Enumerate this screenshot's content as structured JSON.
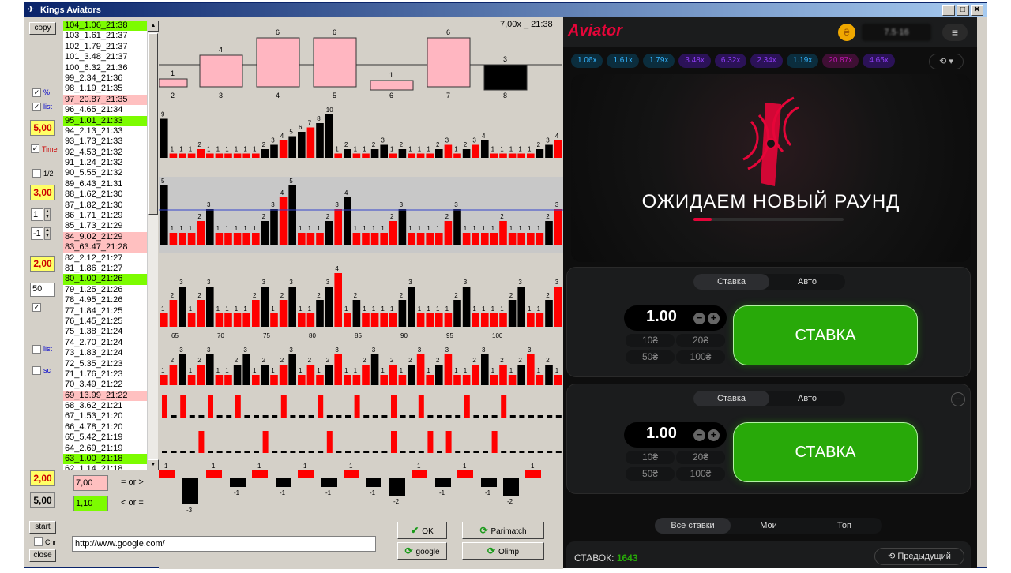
{
  "window": {
    "title": "Kings Aviators"
  },
  "left": {
    "copy": "copy",
    "pct_label": "%",
    "list_label": "list",
    "val1": "5,00",
    "time_label": "Time",
    "half_label": "1/2",
    "val2": "3,00",
    "spin1": "1",
    "spin2": "-1",
    "val3": "2,00",
    "field50": "50",
    "list2_label": "list",
    "sc_label": "sc",
    "val4": "2,00",
    "val5": "5,00",
    "start": "start",
    "chr_label": "Chr",
    "close": "close"
  },
  "list": [
    {
      "t": "104_1.06_21:38",
      "c": "g"
    },
    {
      "t": "103_1.61_21:37",
      "c": ""
    },
    {
      "t": "102_1.79_21:37",
      "c": ""
    },
    {
      "t": "101_3.48_21:37",
      "c": ""
    },
    {
      "t": "100_6.32_21:36",
      "c": ""
    },
    {
      "t": "99_2.34_21:36",
      "c": ""
    },
    {
      "t": "98_1.19_21:35",
      "c": ""
    },
    {
      "t": "97_20.87_21:35",
      "c": "p"
    },
    {
      "t": "96_4.65_21:34",
      "c": ""
    },
    {
      "t": "95_1.01_21:33",
      "c": "g"
    },
    {
      "t": "94_2.13_21:33",
      "c": ""
    },
    {
      "t": "93_1.73_21:33",
      "c": ""
    },
    {
      "t": "92_4.53_21:32",
      "c": ""
    },
    {
      "t": "91_1.24_21:32",
      "c": ""
    },
    {
      "t": "90_5.55_21:32",
      "c": ""
    },
    {
      "t": "89_6.43_21:31",
      "c": ""
    },
    {
      "t": "88_1.62_21:30",
      "c": ""
    },
    {
      "t": "87_1.82_21:30",
      "c": ""
    },
    {
      "t": "86_1.71_21:29",
      "c": ""
    },
    {
      "t": "85_1.73_21:29",
      "c": ""
    },
    {
      "t": "84_9.02_21:29",
      "c": "p"
    },
    {
      "t": "83_63.47_21:28",
      "c": "p"
    },
    {
      "t": "82_2.12_21:27",
      "c": ""
    },
    {
      "t": "81_1.86_21:27",
      "c": ""
    },
    {
      "t": "80_1.00_21:26",
      "c": "g"
    },
    {
      "t": "79_1.25_21:26",
      "c": ""
    },
    {
      "t": "78_4.95_21:26",
      "c": ""
    },
    {
      "t": "77_1.84_21:25",
      "c": ""
    },
    {
      "t": "76_1.45_21:25",
      "c": ""
    },
    {
      "t": "75_1.38_21:24",
      "c": ""
    },
    {
      "t": "74_2.70_21:24",
      "c": ""
    },
    {
      "t": "73_1.83_21:24",
      "c": ""
    },
    {
      "t": "72_5.35_21:23",
      "c": ""
    },
    {
      "t": "71_1.76_21:23",
      "c": ""
    },
    {
      "t": "70_3.49_21:22",
      "c": ""
    },
    {
      "t": "69_13.99_21:22",
      "c": "p"
    },
    {
      "t": "68_3.62_21:21",
      "c": ""
    },
    {
      "t": "67_1.53_21:20",
      "c": ""
    },
    {
      "t": "66_4.78_21:20",
      "c": ""
    },
    {
      "t": "65_5.42_21:19",
      "c": ""
    },
    {
      "t": "64_2.69_21:19",
      "c": ""
    },
    {
      "t": "63_1.00_21:18",
      "c": "g"
    },
    {
      "t": "62_1.14_21:18",
      "c": ""
    }
  ],
  "chart": {
    "header": "7,00x _ 21:38",
    "axis_ticks": [
      "65",
      "70",
      "75",
      "80",
      "85",
      "90",
      "95",
      "100"
    ]
  },
  "bottom": {
    "gt_val": "7,00",
    "gt_label": "= or >",
    "lt_val": "1,10",
    "lt_label": "< or =",
    "url": "http://www.google.com/",
    "ok": "OK",
    "google": "google",
    "parimatch": "Parimatch",
    "olimp": "Olimp"
  },
  "game": {
    "logo": "Aviator",
    "balance": "7.5·16",
    "coin": "₴",
    "multipliers": [
      {
        "v": "1.06x",
        "c": "bl"
      },
      {
        "v": "1.61x",
        "c": "bl"
      },
      {
        "v": "1.79x",
        "c": "bl"
      },
      {
        "v": "3.48x",
        "c": "pu"
      },
      {
        "v": "6.32x",
        "c": "pu"
      },
      {
        "v": "2.34x",
        "c": "pu"
      },
      {
        "v": "1.19x",
        "c": "bl"
      },
      {
        "v": "20.87x",
        "c": "mg"
      },
      {
        "v": "4.65x",
        "c": "pu"
      }
    ],
    "waiting": "ОЖИДАЕМ НОВЫЙ РАУНД",
    "panels": [
      {
        "tab_bet": "Ставка",
        "tab_auto": "Авто",
        "amount": "1.00",
        "q": [
          "10₴",
          "20₴",
          "50₴",
          "100₴"
        ],
        "bet": "СТАВКА"
      },
      {
        "tab_bet": "Ставка",
        "tab_auto": "Авто",
        "amount": "1.00",
        "q": [
          "10₴",
          "20₴",
          "50₴",
          "100₴"
        ],
        "bet": "СТАВКА"
      }
    ],
    "tabs": [
      "Все ставки",
      "Мои",
      "Топ"
    ],
    "bets_label": "СТАВОК:",
    "bets_count": "1643",
    "prev": "Предыдущий"
  },
  "colors": {
    "red": "#ff0000",
    "black": "#000000",
    "pink": "#ffb6c1",
    "green": "#28a909"
  }
}
